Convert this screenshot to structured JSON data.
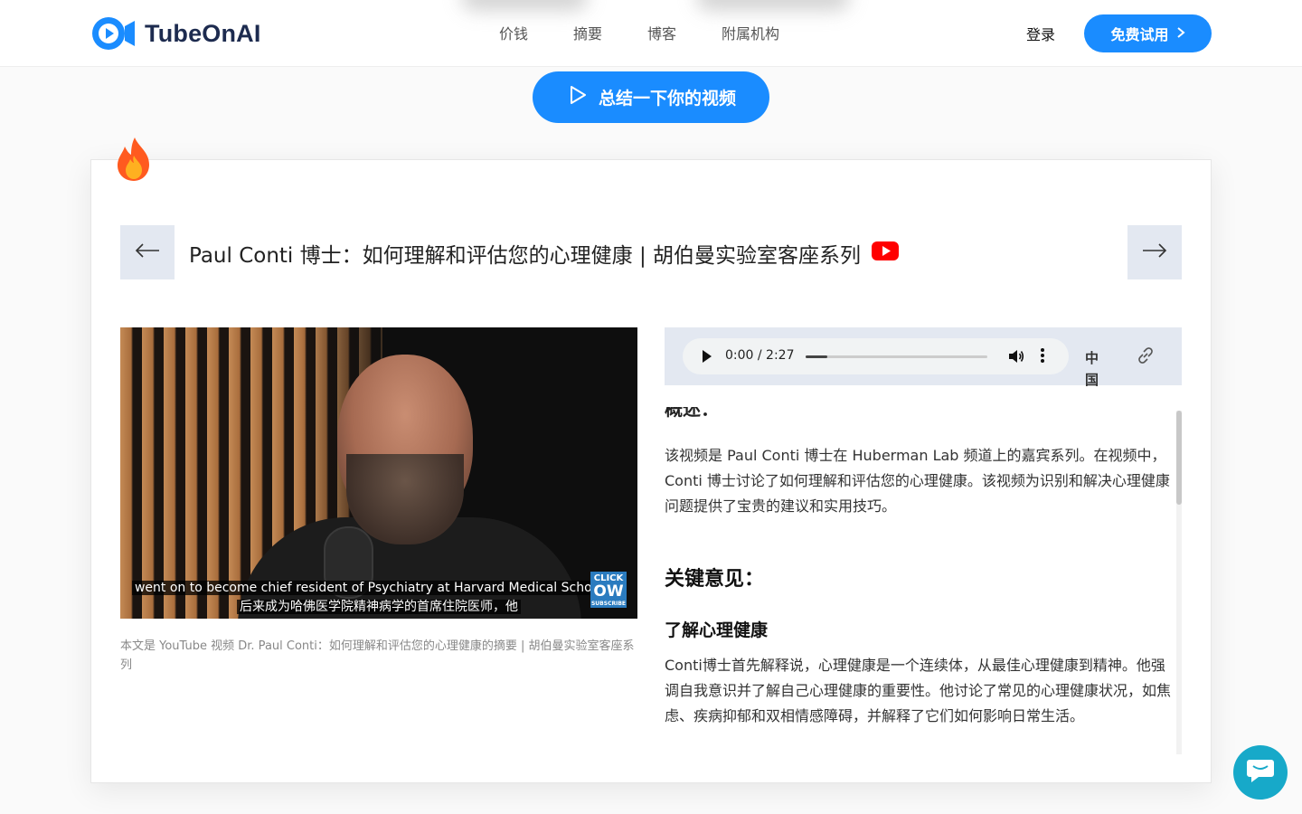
{
  "header": {
    "logo_text": "TubeOnAI",
    "nav": [
      "价钱",
      "摘要",
      "博客",
      "附属机构"
    ],
    "login": "登录",
    "trial_label": "免费试用"
  },
  "summarize_button": "总结一下你的视频",
  "video": {
    "title": "Paul Conti 博士：如何理解和评估您的心理健康 | 胡伯曼实验室客座系列",
    "subtitle_en": "went on to become chief resident of Psychiatry at Harvard Medical School he",
    "subtitle_zh": "后来成为哈佛医学院精神病学的首席住院医师，他",
    "badge_top": "CLICK",
    "badge_mid": "OW",
    "badge_bottom": "SUBSCRIBE",
    "caption": "本文是 YouTube 视频 Dr. Paul Conti：如何理解和评估您的心理健康的摘要 | 胡伯曼实验室客座系列"
  },
  "audio": {
    "time": "0:00 / 2:27",
    "progress": 0.12,
    "language": "中国"
  },
  "summary": {
    "overview_heading": "概述：",
    "overview_text": "该视频是 Paul Conti 博士在 Huberman Lab 频道上的嘉宾系列。在视频中，Conti 博士讨论了如何理解和评估您的心理健康。该视频为识别和解决心理健康问题提供了宝贵的建议和实用技巧。",
    "key_heading": "关键意见：",
    "section_heading": "了解心理健康",
    "section_text": "Conti博士首先解释说，心理健康是一个连续体，从最佳心理健康到精神。他强调自我意识并了解自己心理健康的重要性。他讨论了常见的心理健康状况，如焦虑、疾病抑郁和双相情感障碍，并解释了它们如何影响日常生活。"
  },
  "colors": {
    "brand": "#1a8cff",
    "chat": "#17a9c9",
    "youtube": "#ff0000"
  }
}
